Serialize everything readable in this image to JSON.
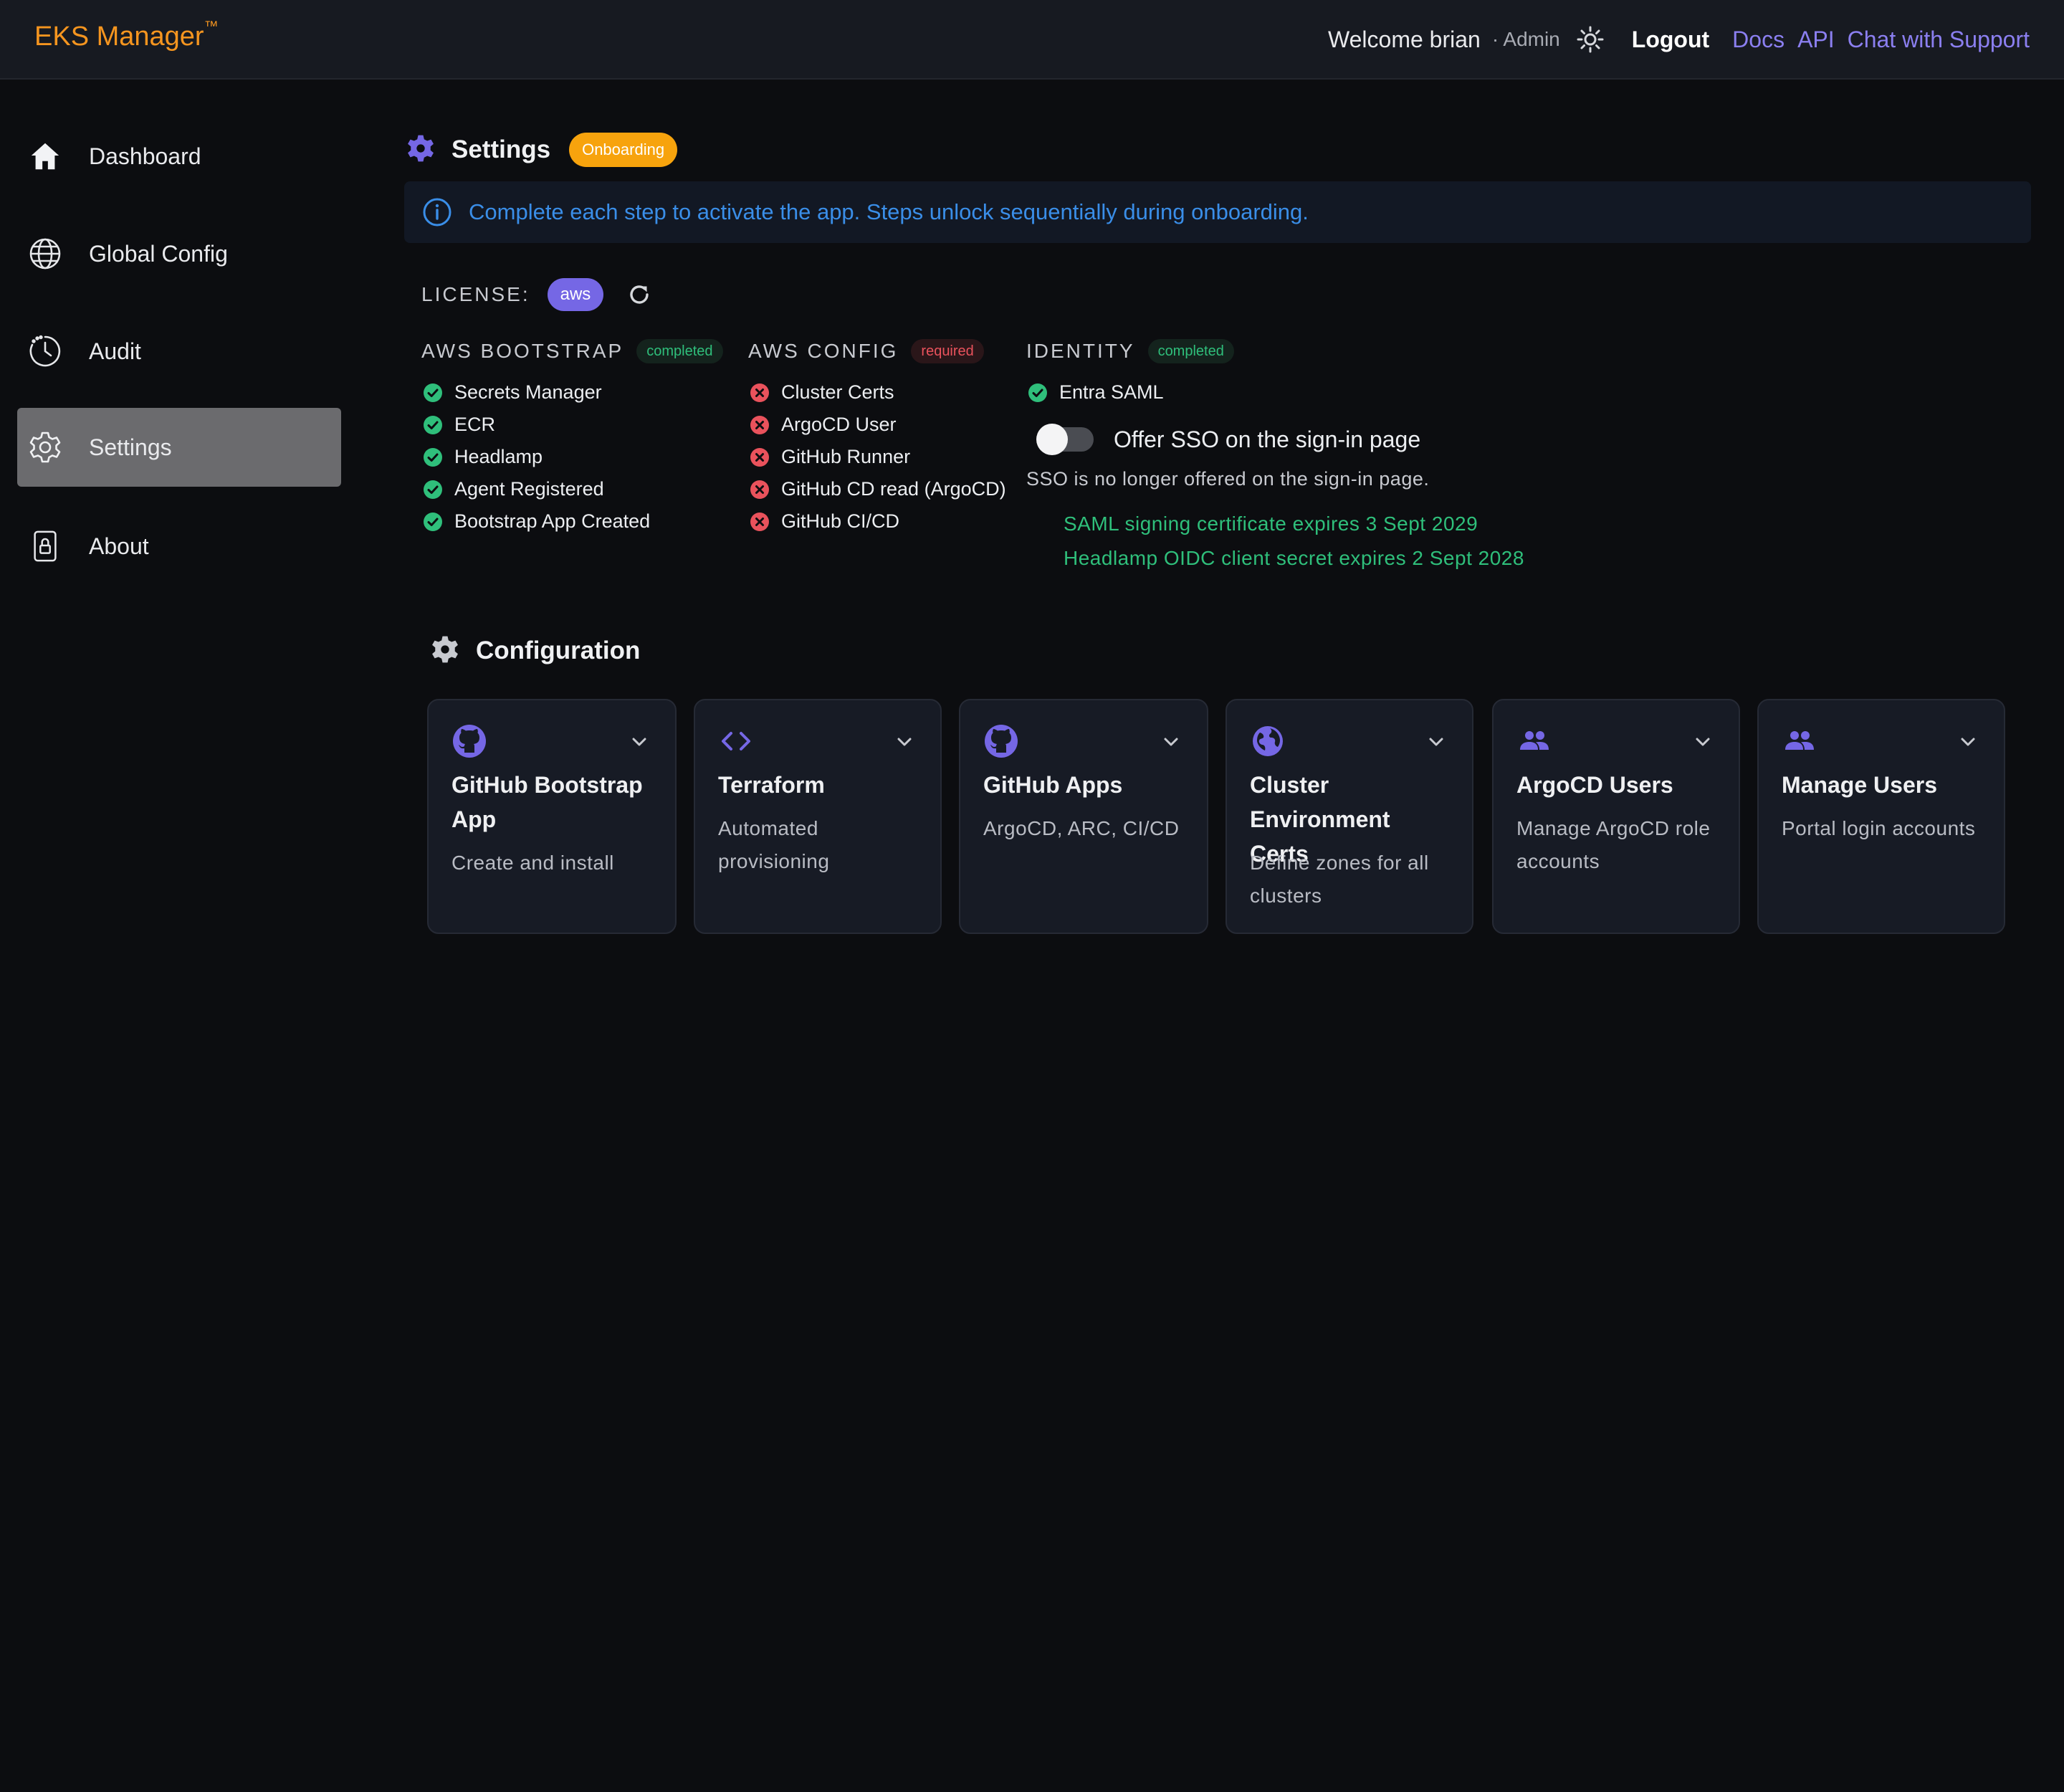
{
  "header": {
    "brand": "EKS Manager",
    "brand_tm": "™",
    "welcome": "Welcome brian",
    "role": "· Admin",
    "logout": "Logout",
    "links": [
      "Docs",
      "API",
      "Chat with Support"
    ],
    "theme_icon": "sun-icon"
  },
  "sidebar": {
    "items": [
      {
        "label": "Dashboard",
        "icon": "home-icon",
        "active": false
      },
      {
        "label": "Global Config",
        "icon": "globe-icon",
        "active": false
      },
      {
        "label": "Audit",
        "icon": "clock-icon",
        "active": false
      },
      {
        "label": "Settings",
        "icon": "gear-icon",
        "active": true
      },
      {
        "label": "About",
        "icon": "lock-icon",
        "active": false
      }
    ]
  },
  "page": {
    "title": "Settings",
    "badge": "Onboarding",
    "info": "Complete each step to activate the app. Steps unlock sequentially during onboarding."
  },
  "license": {
    "label": "LICENSE:",
    "value": "aws"
  },
  "groups": [
    {
      "title": "AWS BOOTSTRAP",
      "status": "completed",
      "items": [
        {
          "label": "Secrets Manager",
          "ok": true
        },
        {
          "label": "ECR",
          "ok": true
        },
        {
          "label": "Headlamp",
          "ok": true
        },
        {
          "label": "Agent Registered",
          "ok": true
        },
        {
          "label": "Bootstrap App Created",
          "ok": true
        }
      ]
    },
    {
      "title": "AWS CONFIG",
      "status": "required",
      "items": [
        {
          "label": "Cluster Certs",
          "ok": false
        },
        {
          "label": "ArgoCD User",
          "ok": false
        },
        {
          "label": "GitHub Runner",
          "ok": false
        },
        {
          "label": "GitHub CD read (ArgoCD)",
          "ok": false
        },
        {
          "label": "GitHub CI/CD",
          "ok": false
        }
      ]
    },
    {
      "title": "IDENTITY",
      "status": "completed",
      "items": [
        {
          "label": "Entra SAML",
          "ok": true
        }
      ]
    }
  ],
  "sso": {
    "toggle_label": "Offer SSO on the sign-in page",
    "enabled": false,
    "note": "SSO is no longer offered on the sign-in page.",
    "expiries": [
      "SAML signing certificate expires 3 Sept 2029",
      "Headlamp OIDC client secret expires 2 Sept 2028"
    ]
  },
  "configuration": {
    "title": "Configuration",
    "cards": [
      {
        "title": "GitHub Bootstrap App",
        "desc": "Create and install",
        "icon": "github-icon"
      },
      {
        "title": "Terraform",
        "desc": "Automated provisioning",
        "icon": "code-icon"
      },
      {
        "title": "GitHub Apps",
        "desc": "ArgoCD, ARC, CI/CD",
        "icon": "github-icon"
      },
      {
        "title": "Cluster Environment Certs",
        "desc": "Define zones for all clusters",
        "icon": "globe-icon"
      },
      {
        "title": "ArgoCD Users",
        "desc": "Manage ArgoCD role accounts",
        "icon": "users-icon"
      },
      {
        "title": "Manage Users",
        "desc": "Portal login accounts",
        "icon": "users-icon"
      }
    ]
  },
  "colors": {
    "brand": "#f5951f",
    "accent": "#7567e5",
    "link": "#8b7ff0",
    "info": "#3a8ee8",
    "success": "#2fbf7b",
    "danger": "#e9525c",
    "warning": "#f7a30d"
  }
}
